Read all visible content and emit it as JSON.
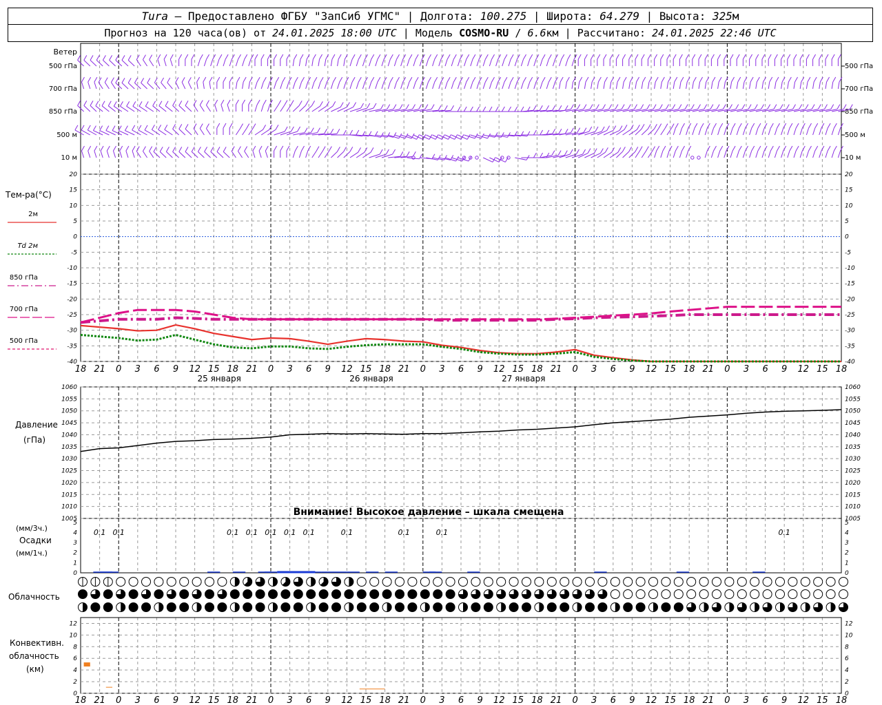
{
  "header": {
    "station": "Tura",
    "dash": " – ",
    "provider": "Предоставлено ФГБУ \"ЗапСиб УГМС\"",
    "sep": " | ",
    "lon_label": "Долгота: ",
    "lon_value": "100.275",
    "lat_label": "Широта: ",
    "lat_value": "64.279",
    "alt_label": "Высота: ",
    "alt_value": "325",
    "alt_unit": "м",
    "forecast_label": "Прогноз на 120 часа(ов) от ",
    "forecast_time": "24.01.2025 18:00 UTC",
    "model_label": "Модель ",
    "model_name": "COSMO-RU",
    "model_sep": " / ",
    "model_res": "6.6",
    "model_res_unit": "км",
    "calc_label": "Рассчитано: ",
    "calc_time": "24.01.2025 22:46 UTC"
  },
  "colors": {
    "wind": "#8a2be2",
    "t2m": "#e8322d",
    "td2m": "#118811",
    "t850": "#cc1a8c",
    "t700": "#dd1188",
    "t500": "#e0166e",
    "zero": "#2255dd",
    "grid": "#999999",
    "pressure": "#000000",
    "precip": "#1a3bd6",
    "conv": "#f08020"
  },
  "chart_data": [
    {
      "type": "line",
      "panel": "wind",
      "title": "Ветер",
      "levels": [
        "500 гПа",
        "700 гПа",
        "850 гПа",
        "500 м",
        "10 м"
      ],
      "grid": true
    },
    {
      "type": "line",
      "panel": "temperature",
      "ylabel": "Тем-ра(°C)",
      "ylim": [
        -40,
        20
      ],
      "yticks": [
        "20",
        "15",
        "10",
        "5",
        "0",
        "-5",
        "-10",
        "-15",
        "-20",
        "-25",
        "-30",
        "-35",
        "-40"
      ],
      "x_hours": [
        0,
        3,
        6,
        9,
        12,
        15,
        18,
        21,
        24,
        27,
        30,
        33,
        36,
        39,
        42,
        45,
        48,
        51,
        54,
        57,
        60,
        63,
        66,
        69,
        72,
        75,
        78,
        81,
        84,
        87,
        90,
        93,
        96,
        99,
        102,
        105,
        108,
        111,
        114,
        117,
        120
      ],
      "series": [
        {
          "name": "2м",
          "values": [
            -28.5,
            -29,
            -29.5,
            -30.2,
            -30,
            -28.3,
            -29.5,
            -31,
            -32,
            -33,
            -32.5,
            -32.7,
            -33.5,
            -34.5,
            -33.5,
            -32.7,
            -33,
            -33.5,
            -33.7,
            -34.8,
            -35.5,
            -36.5,
            -37.2,
            -37.5,
            -37.5,
            -37,
            -36.2,
            -38,
            -38.8,
            -39.5,
            -40,
            -40,
            -40,
            -40,
            -40,
            -40,
            -40,
            -40,
            -40,
            -40,
            -40
          ]
        },
        {
          "name": "Td 2м",
          "values": [
            -31.5,
            -32,
            -32.5,
            -33.3,
            -33,
            -31.5,
            -33,
            -34.5,
            -35.5,
            -35.8,
            -35.2,
            -35.2,
            -35.8,
            -36,
            -35.3,
            -34.8,
            -34.5,
            -34.5,
            -34.5,
            -35.3,
            -36,
            -37,
            -37.5,
            -37.8,
            -37.8,
            -37.5,
            -37,
            -38.5,
            -39.2,
            -39.7,
            -40,
            -40,
            -40,
            -40,
            -40,
            -40,
            -40,
            -40,
            -40,
            -40,
            -40
          ]
        },
        {
          "name": "850 гПа",
          "values": [
            -27.5,
            -27,
            -26.5,
            -26.5,
            -26.5,
            -26,
            -26.2,
            -26.5,
            -26.5,
            -26.5,
            -26.5,
            -26.5,
            -26.5,
            -26.5,
            -26.5,
            -26.5,
            -26.5,
            -26.5,
            -26.5,
            -26.8,
            -26.8,
            -26.8,
            -26.8,
            -26.8,
            -26.8,
            -26.5,
            -26.3,
            -26,
            -25.8,
            -25.7,
            -25.5,
            -25.3,
            -25,
            -25,
            -25,
            -25,
            -25,
            -25,
            -25,
            -25,
            -25
          ]
        },
        {
          "name": "700 гПа",
          "values": [
            -27.5,
            -26,
            -24.5,
            -23.5,
            -23.5,
            -23.5,
            -24,
            -25,
            -26,
            -26.5,
            -26.5,
            -26.5,
            -26.5,
            -26.5,
            -26.5,
            -26.5,
            -26.5,
            -26.5,
            -26.5,
            -26.5,
            -26.5,
            -26.5,
            -26.5,
            -26.5,
            -26.5,
            -26.3,
            -26,
            -25.7,
            -25.3,
            -25,
            -24.6,
            -24,
            -23.5,
            -23,
            -22.5,
            -22.5,
            -22.5,
            -22.5,
            -22.5,
            -22.5,
            -22.5
          ]
        },
        {
          "name": "500 гПа",
          "values": []
        }
      ],
      "grid": true
    },
    {
      "type": "line",
      "panel": "pressure",
      "ylabel": "Давление",
      "yunit": "(гПа)",
      "ylim": [
        1005,
        1060
      ],
      "yticks": [
        "1060",
        "1055",
        "1050",
        "1045",
        "1040",
        "1035",
        "1030",
        "1025",
        "1020",
        "1015",
        "1010",
        "1005"
      ],
      "x_hours": [
        0,
        3,
        6,
        9,
        12,
        15,
        18,
        21,
        24,
        27,
        30,
        33,
        36,
        39,
        42,
        45,
        48,
        51,
        54,
        57,
        60,
        63,
        66,
        69,
        72,
        75,
        78,
        81,
        84,
        87,
        90,
        93,
        96,
        99,
        102,
        105,
        108,
        111,
        114,
        117,
        120
      ],
      "series": [
        {
          "name": "",
          "values": [
            1033,
            1034.2,
            1034.5,
            1035.5,
            1036.5,
            1037.2,
            1037.5,
            1038,
            1038.2,
            1038.5,
            1039,
            1040,
            1040.2,
            1040.5,
            1040.3,
            1040.5,
            1040.3,
            1040.2,
            1040.5,
            1040.5,
            1040.8,
            1041.2,
            1041.5,
            1042,
            1042.3,
            1042.8,
            1043.3,
            1044.2,
            1045,
            1045.5,
            1046,
            1046.5,
            1047.3,
            1047.8,
            1048.3,
            1049,
            1049.5,
            1049.8,
            1050,
            1050.2,
            1050.5
          ]
        }
      ],
      "warning": "Внимание! Высокое давление – шкала смещена",
      "grid": true
    },
    {
      "type": "bar",
      "panel": "precipitation",
      "ylabel_1": "(мм/3ч.)",
      "ylabel_2": "Осадки",
      "ylabel_3": "(мм/1ч.)",
      "ylim": [
        0,
        5
      ],
      "yticks": [
        "5",
        "4",
        "3",
        "2",
        "1",
        "0"
      ],
      "labels": [
        {
          "hour": 3,
          "text": "0.1"
        },
        {
          "hour": 6,
          "text": "0.1"
        },
        {
          "hour": 24,
          "text": "0.1"
        },
        {
          "hour": 27,
          "text": "0.1"
        },
        {
          "hour": 30,
          "text": "0.1"
        },
        {
          "hour": 33,
          "text": "0.1"
        },
        {
          "hour": 36,
          "text": "0.1"
        },
        {
          "hour": 42,
          "text": "0.1"
        },
        {
          "hour": 51,
          "text": "0.1"
        },
        {
          "hour": 57,
          "text": "0.1"
        },
        {
          "hour": 111,
          "text": "0.1"
        }
      ]
    },
    {
      "type": "table",
      "panel": "cloudiness",
      "label": "Облачность",
      "rows": 3,
      "symbol": "circle-oktas"
    },
    {
      "type": "bar",
      "panel": "convective",
      "ylabel_1": "Конвективн.",
      "ylabel_2": "облачность",
      "ylabel_3": "(км)",
      "ylim": [
        0,
        13
      ],
      "yticks": [
        "12",
        "10",
        "8",
        "6",
        "4",
        "2",
        "0"
      ],
      "bars": [
        {
          "from": 0.5,
          "to": 1.5,
          "bottom": 4.6,
          "top": 5.3
        },
        {
          "from": 4,
          "to": 5,
          "bottom": 1.0,
          "top": 1.1
        },
        {
          "from": 44,
          "to": 48,
          "bottom": 0.7,
          "top": 0.8
        }
      ]
    }
  ],
  "axis": {
    "hour_labels": [
      "18",
      "21",
      "0",
      "3",
      "6",
      "9",
      "12",
      "15",
      "18",
      "21",
      "0",
      "3",
      "6",
      "9",
      "12",
      "15",
      "18",
      "21",
      "0",
      "3",
      "6",
      "9",
      "12",
      "15",
      "18",
      "21",
      "0",
      "3",
      "6",
      "9",
      "12",
      "15",
      "18",
      "21",
      "0",
      "3",
      "6",
      "9",
      "12",
      "15",
      "18",
      "21",
      "0"
    ],
    "days": [
      {
        "label": "25 января",
        "hour": 21
      },
      {
        "label": "26 января",
        "hour": 45
      },
      {
        "label": "27 января",
        "hour": 69
      }
    ]
  },
  "legend": {
    "temp_title": "Тем-ра(°C)",
    "items": [
      "2м",
      "Td 2м",
      "850 гПа",
      "700 гПа",
      "500 гПа"
    ],
    "wind_title": "Ветер"
  }
}
